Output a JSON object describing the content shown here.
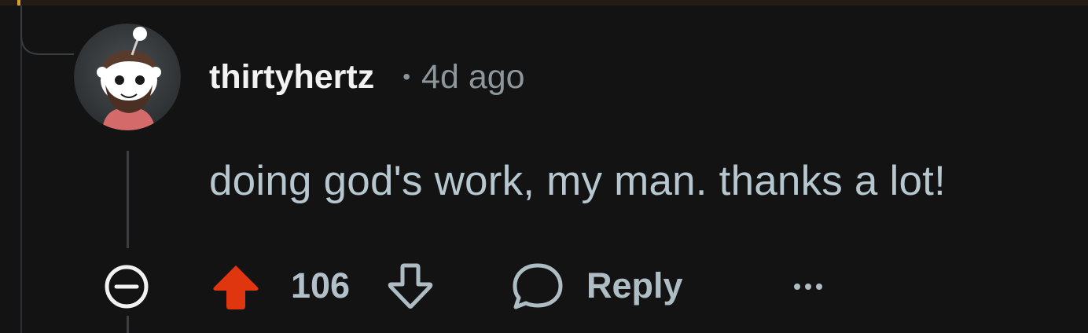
{
  "comment": {
    "author": "thirtyhertz",
    "separator": "•",
    "timestamp": "4d ago",
    "body": "doing god's work, my man. thanks a lot!",
    "score": "106",
    "reply_label": "Reply"
  },
  "icons": {
    "collapse": "minus-circle-icon",
    "upvote": "upvote-arrow-icon",
    "downvote": "downvote-arrow-icon",
    "reply": "speech-bubble-icon",
    "more": "ellipsis-icon"
  },
  "colors": {
    "background": "#131313",
    "upvote_active": "#e0360f",
    "username": "#f2f2f2",
    "body_text": "#b7c7d0",
    "muted": "#8c969b"
  }
}
